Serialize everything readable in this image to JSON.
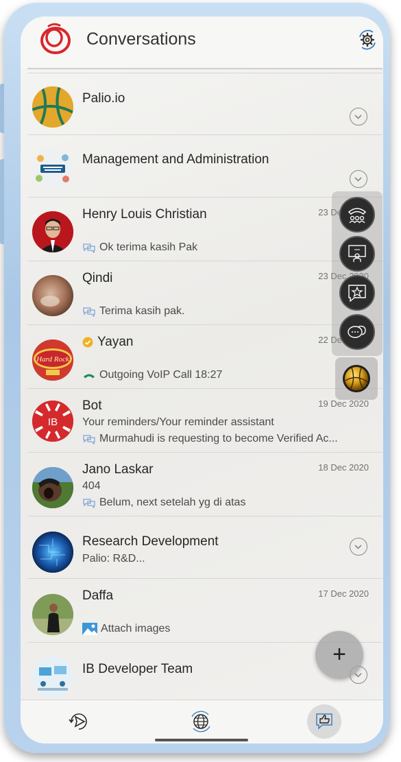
{
  "header": {
    "title": "Conversations",
    "logo_icon": "palio-logo-icon",
    "settings_icon": "settings-sync-icon"
  },
  "conversations": [
    {
      "name": "Palio.io",
      "type": "group",
      "avatar": "palio-io-avatar"
    },
    {
      "name": "Management and Administration",
      "type": "group",
      "avatar": "project-management-avatar"
    },
    {
      "name": "Henry Louis Christian",
      "date": "23 Dec 2020",
      "preview": "Ok terima kasih Pak",
      "preview_icon": "message-read-icon"
    },
    {
      "name": "Qindi",
      "date": "23 Dec 2020",
      "preview": "Terima kasih pak.",
      "preview_icon": "message-read-icon"
    },
    {
      "name": "Yayan",
      "date": "22 Dec 2020",
      "verified": true,
      "preview": "Outgoing VoIP Call 18:27",
      "preview_icon": "phone-outgoing-icon"
    },
    {
      "name": "Bot",
      "date": "19 Dec 2020",
      "subline": "Your reminders/Your reminder assistant",
      "preview": "Murmahudi is requesting to become Verified Ac...",
      "preview_icon": "message-read-icon"
    },
    {
      "name": "Jano Laskar",
      "date": "18 Dec 2020",
      "subline": "404",
      "preview": "Belum, next setelah yg di atas",
      "preview_icon": "message-read-icon"
    },
    {
      "name": "Research Development",
      "type": "group",
      "subline": "Palio: R&D..."
    },
    {
      "name": "Daffa",
      "date": "17 Dec 2020",
      "preview": "Attach images",
      "preview_icon": "image-icon"
    },
    {
      "name": "IB Developer Team",
      "type": "group"
    }
  ],
  "floating_actions": [
    "conference-call-icon",
    "broadcast-presenter-icon",
    "favorite-chat-icon",
    "chat-bubbles-icon",
    "palio-ball-icon"
  ],
  "fab": {
    "label": "+"
  },
  "bottom_nav": [
    "send-icon",
    "globe-icon",
    "thumbs-up-chat-icon"
  ],
  "colors": {
    "accent_red": "#d9262c",
    "verified": "#f1b020",
    "call_green": "#1d8a67",
    "fab_dark": "#2c2c2c"
  }
}
